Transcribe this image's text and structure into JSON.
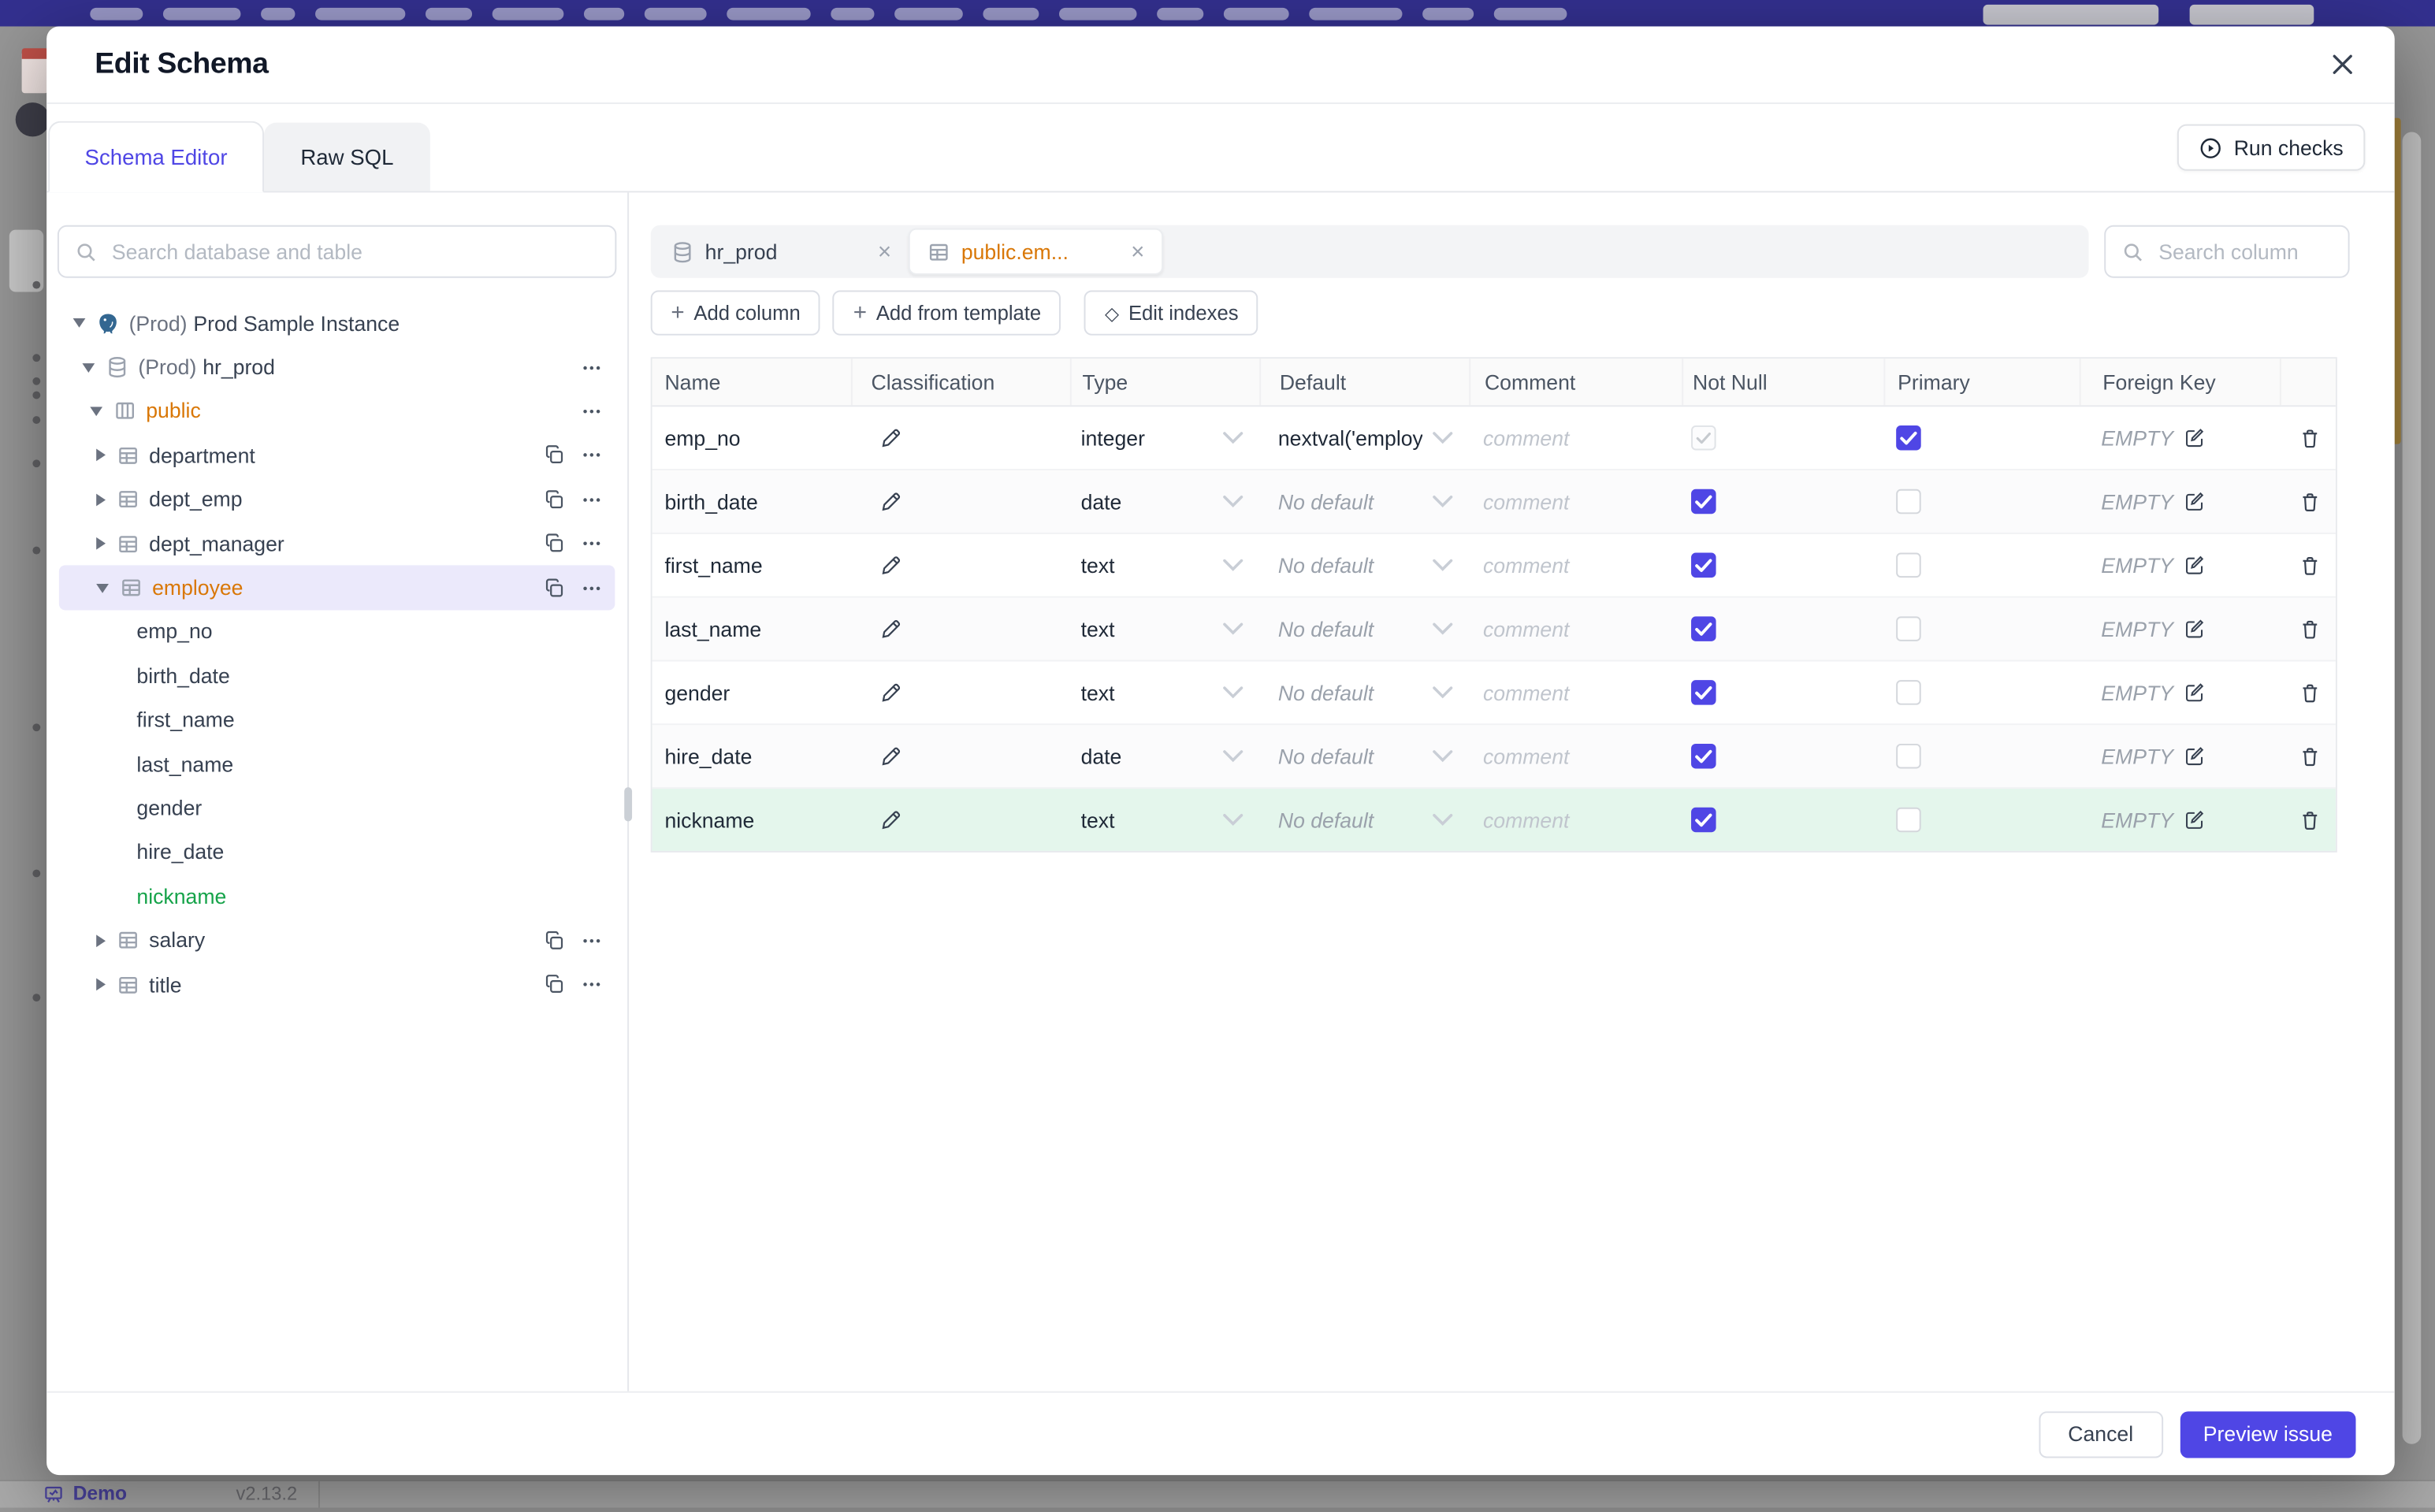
{
  "colors": {
    "accent": "#4f46e5",
    "topbar": "#33308f",
    "amber": "#d97706",
    "green": "#16a34a",
    "green_row_bg": "#e4f6ec",
    "selected_row_bg": "#ebe9fb"
  },
  "background_page": {
    "brand_label": "Demo",
    "version": "v2.13.2"
  },
  "modal": {
    "title": "Edit Schema",
    "tabs": [
      {
        "label": "Schema Editor",
        "active": true
      },
      {
        "label": "Raw SQL",
        "active": false
      }
    ],
    "run_checks_label": "Run checks",
    "sidebar": {
      "search_placeholder": "Search database and table",
      "tree": [
        {
          "level": 0,
          "type": "instance",
          "icon": "postgres-icon",
          "prefix": "(Prod)",
          "label": "Prod Sample Instance",
          "expanded": true,
          "actions": []
        },
        {
          "level": 1,
          "type": "database",
          "icon": "database-icon",
          "prefix": "(Prod)",
          "label": "hr_prod",
          "expanded": true,
          "actions": [
            "menu"
          ]
        },
        {
          "level": 2,
          "type": "schema",
          "icon": "schema-icon",
          "label": "public",
          "expanded": true,
          "accent": "amber",
          "actions": [
            "menu"
          ]
        },
        {
          "level": 3,
          "type": "table",
          "icon": "table-icon",
          "label": "department",
          "expanded": false,
          "actions": [
            "copy",
            "menu"
          ]
        },
        {
          "level": 3,
          "type": "table",
          "icon": "table-icon",
          "label": "dept_emp",
          "expanded": false,
          "actions": [
            "copy",
            "menu"
          ]
        },
        {
          "level": 3,
          "type": "table",
          "icon": "table-icon",
          "label": "dept_manager",
          "expanded": false,
          "actions": [
            "copy",
            "menu"
          ]
        },
        {
          "level": 3,
          "type": "table",
          "icon": "table-icon",
          "label": "employee",
          "expanded": true,
          "selected": true,
          "accent": "amber",
          "actions": [
            "copy",
            "menu"
          ]
        },
        {
          "level": 4,
          "type": "column",
          "label": "emp_no"
        },
        {
          "level": 4,
          "type": "column",
          "label": "birth_date"
        },
        {
          "level": 4,
          "type": "column",
          "label": "first_name"
        },
        {
          "level": 4,
          "type": "column",
          "label": "last_name"
        },
        {
          "level": 4,
          "type": "column",
          "label": "gender"
        },
        {
          "level": 4,
          "type": "column",
          "label": "hire_date"
        },
        {
          "level": 4,
          "type": "column",
          "label": "nickname",
          "accent": "green"
        },
        {
          "level": 3,
          "type": "table",
          "icon": "table-icon",
          "label": "salary",
          "expanded": false,
          "actions": [
            "copy",
            "menu"
          ]
        },
        {
          "level": 3,
          "type": "table",
          "icon": "table-icon",
          "label": "title",
          "expanded": false,
          "actions": [
            "copy",
            "menu"
          ]
        }
      ]
    },
    "editor": {
      "tabs": [
        {
          "label": "hr_prod",
          "icon": "database-icon",
          "active": false
        },
        {
          "label": "public.em...",
          "icon": "table-icon",
          "active": true
        }
      ],
      "search_placeholder": "Search column",
      "toolbar": [
        {
          "id": "add-column-button",
          "icon": "plus",
          "label": "Add column"
        },
        {
          "id": "add-from-template-button",
          "icon": "plus",
          "label": "Add from template"
        },
        {
          "id": "edit-indexes-button",
          "icon": "diamond",
          "label": "Edit indexes"
        }
      ],
      "table": {
        "headers": [
          "Name",
          "Classification",
          "Type",
          "Default",
          "Comment",
          "Not Null",
          "Primary",
          "Foreign Key"
        ],
        "comment_placeholder": "comment",
        "fk_empty_label": "EMPTY",
        "rows": [
          {
            "name": "emp_no",
            "type": "integer",
            "default": "nextval('employ",
            "default_is_placeholder": false,
            "not_null_checked": true,
            "not_null_disabled": true,
            "primary_checked": true,
            "new": false
          },
          {
            "name": "birth_date",
            "type": "date",
            "default": "No default",
            "default_is_placeholder": true,
            "not_null_checked": true,
            "not_null_disabled": false,
            "primary_checked": false,
            "new": false
          },
          {
            "name": "first_name",
            "type": "text",
            "default": "No default",
            "default_is_placeholder": true,
            "not_null_checked": true,
            "not_null_disabled": false,
            "primary_checked": false,
            "new": false
          },
          {
            "name": "last_name",
            "type": "text",
            "default": "No default",
            "default_is_placeholder": true,
            "not_null_checked": true,
            "not_null_disabled": false,
            "primary_checked": false,
            "new": false
          },
          {
            "name": "gender",
            "type": "text",
            "default": "No default",
            "default_is_placeholder": true,
            "not_null_checked": true,
            "not_null_disabled": false,
            "primary_checked": false,
            "new": false
          },
          {
            "name": "hire_date",
            "type": "date",
            "default": "No default",
            "default_is_placeholder": true,
            "not_null_checked": true,
            "not_null_disabled": false,
            "primary_checked": false,
            "new": false
          },
          {
            "name": "nickname",
            "type": "text",
            "default": "No default",
            "default_is_placeholder": true,
            "not_null_checked": true,
            "not_null_disabled": false,
            "primary_checked": false,
            "new": true
          }
        ]
      }
    },
    "footer": {
      "cancel_label": "Cancel",
      "primary_label": "Preview issue"
    }
  }
}
